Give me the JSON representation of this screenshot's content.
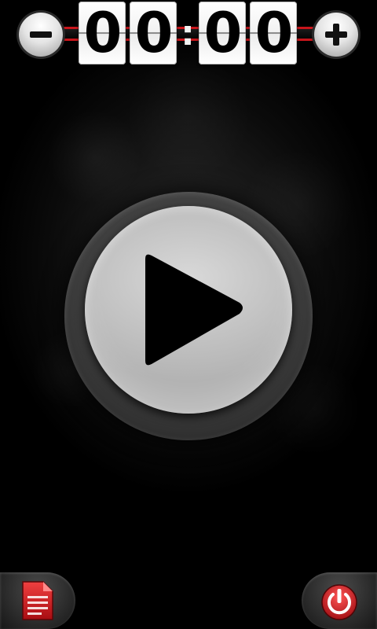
{
  "app": {
    "accent_color": "#c8151b"
  },
  "timer": {
    "minutes_tens": "0",
    "minutes_ones": "0",
    "separator": ":",
    "seconds_tens": "0",
    "seconds_ones": "0",
    "decrement_icon": "minus-icon",
    "increment_icon": "plus-icon"
  },
  "main": {
    "play_icon": "play-icon"
  },
  "footer": {
    "left_icon": "document-icon",
    "right_icon": "power-icon"
  }
}
